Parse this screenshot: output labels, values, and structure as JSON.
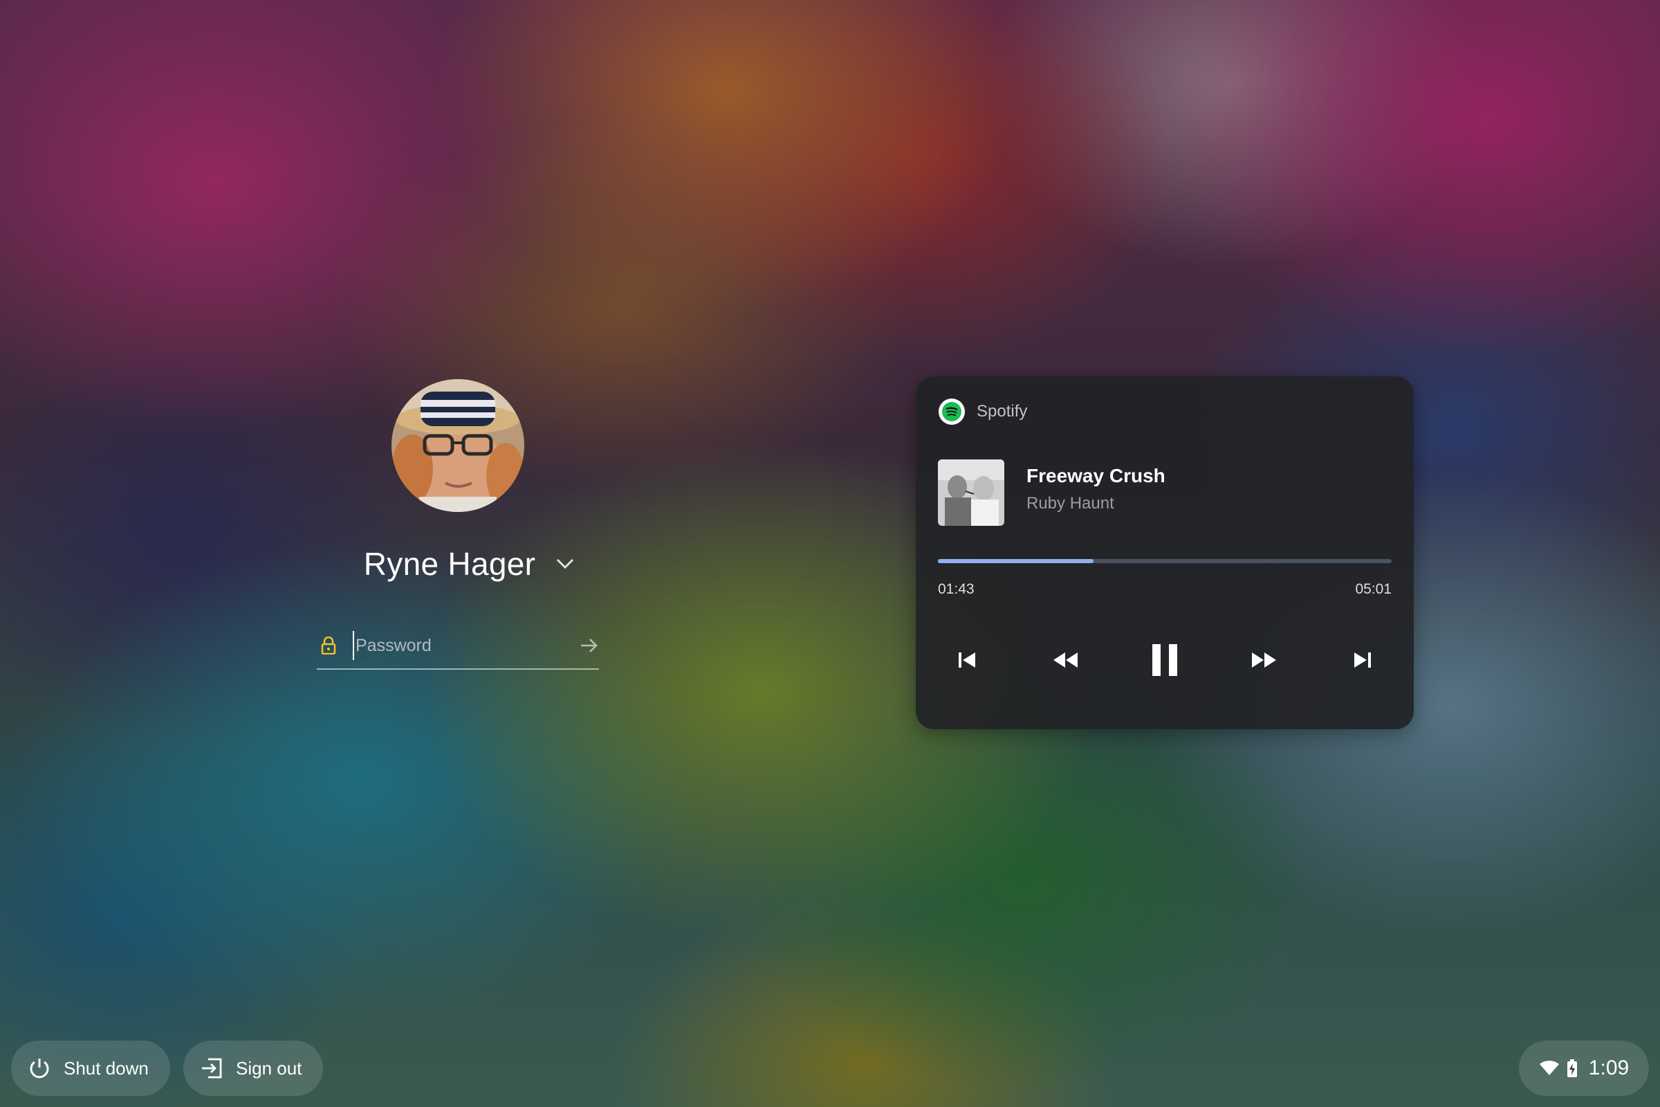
{
  "user": {
    "name": "Ryne Hager",
    "password_placeholder": "Password"
  },
  "media": {
    "app_name": "Spotify",
    "track_title": "Freeway Crush",
    "artist": "Ruby Haunt",
    "elapsed": "01:43",
    "duration": "05:01",
    "progress_fraction": 0.343,
    "progress_color": "#8fb0f0",
    "controls": [
      "previous-track-icon",
      "rewind-icon",
      "pause-icon",
      "fast-forward-icon",
      "next-track-icon"
    ]
  },
  "shelf": {
    "shut_down_label": "Shut down",
    "sign_out_label": "Sign out",
    "clock": "1:09"
  },
  "colors": {
    "lock_accent": "#f5c02a",
    "spotify_green": "#1db954"
  }
}
